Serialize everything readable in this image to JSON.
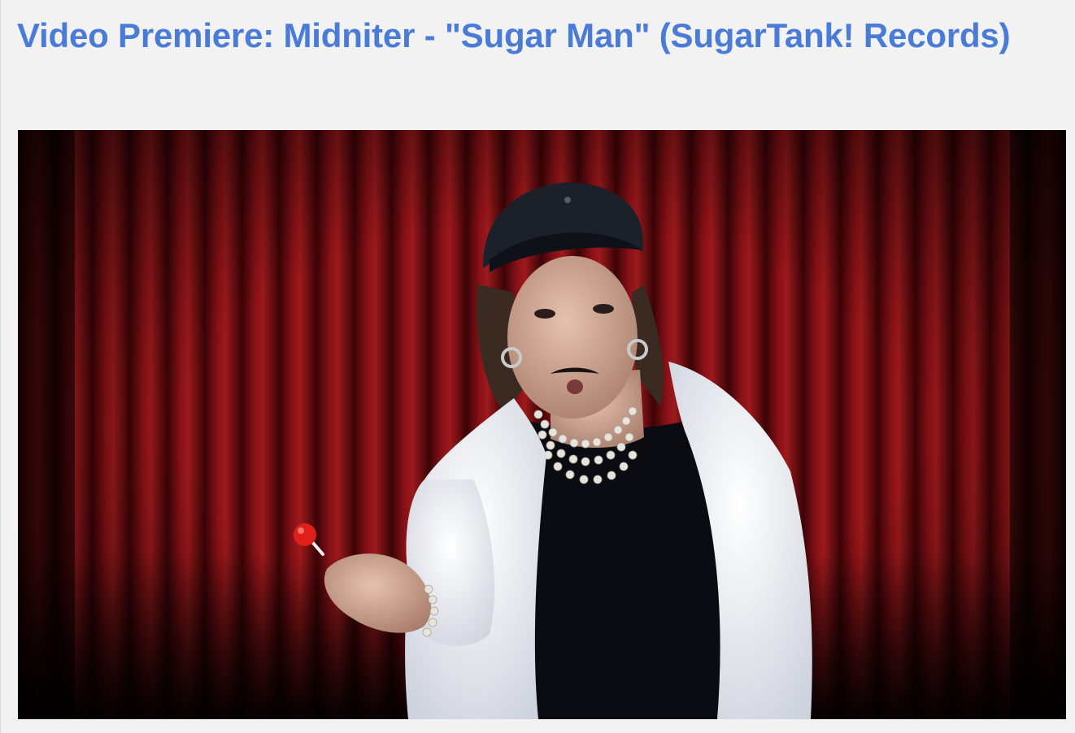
{
  "post": {
    "title": "Video Premiere: Midniter - \"Sugar Man\" (SugarTank! Records)"
  },
  "video_still": {
    "alt": "Performer in a black leather cap, white faux-fur jacket and pearl necklaces holding a red lollipop in front of a red velvet curtain"
  },
  "colors": {
    "title_link": "#4a7bd6",
    "page_background": "#f2f2f2",
    "curtain": "#7a0c10"
  }
}
